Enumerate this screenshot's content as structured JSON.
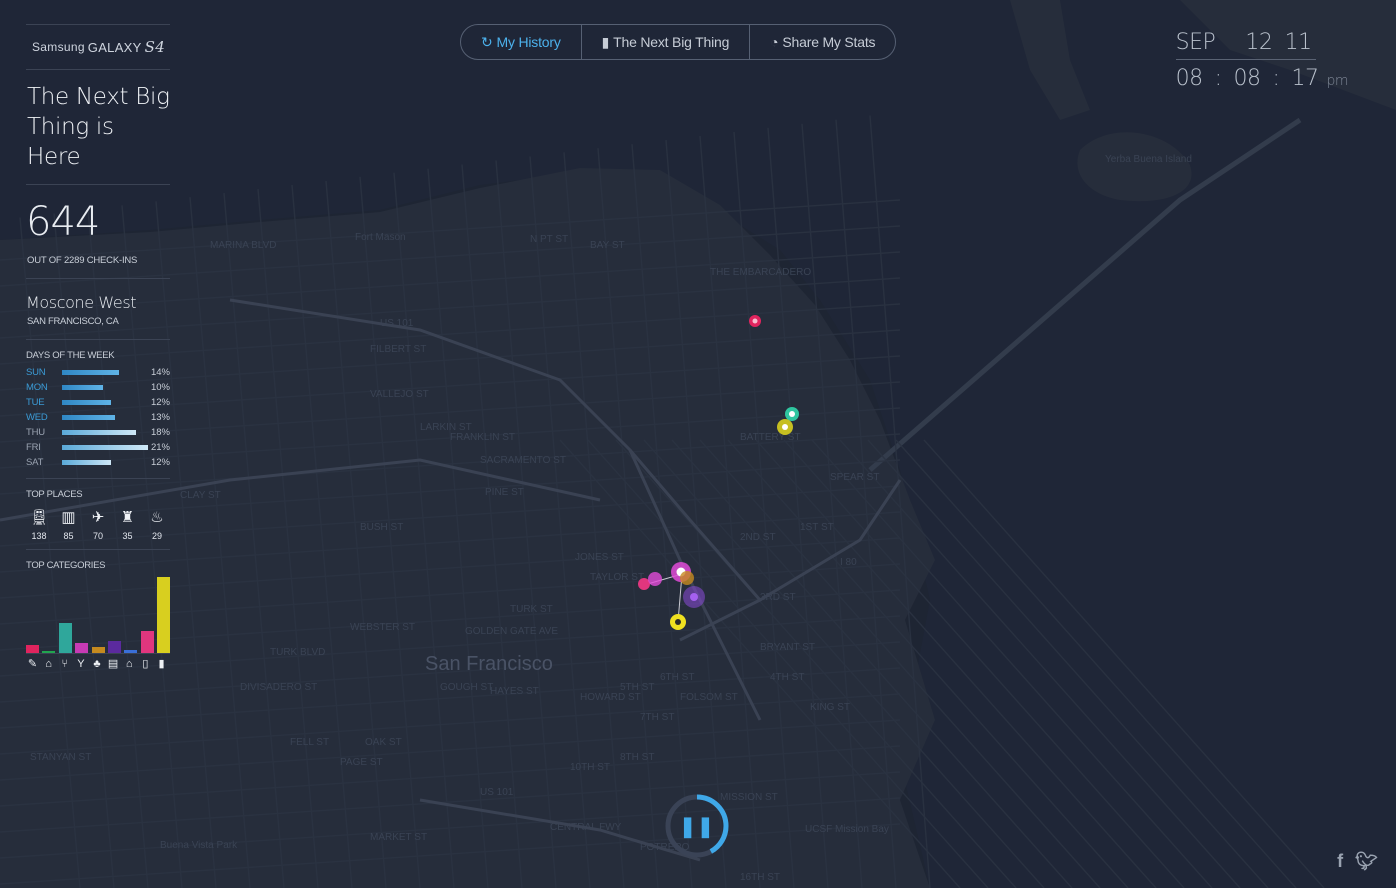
{
  "brand": {
    "maker": "Samsung",
    "product": "GALAXY",
    "model": "S4"
  },
  "headline": "The Next Big Thing is Here",
  "checkins": {
    "count": "644",
    "subtitle": "OUT OF 2289 CHECK-INS"
  },
  "venue": {
    "name": "Moscone West",
    "location": "SAN FRANCISCO, CA"
  },
  "days_of_week": {
    "label": "DAYS OF THE WEEK",
    "days": [
      {
        "day": "SUN",
        "pct": "14%",
        "value": 14
      },
      {
        "day": "MON",
        "pct": "10%",
        "value": 10
      },
      {
        "day": "TUE",
        "pct": "12%",
        "value": 12
      },
      {
        "day": "WED",
        "pct": "13%",
        "value": 13
      },
      {
        "day": "THU",
        "pct": "18%",
        "value": 18
      },
      {
        "day": "FRI",
        "pct": "21%",
        "value": 21
      },
      {
        "day": "SAT",
        "pct": "12%",
        "value": 12
      }
    ]
  },
  "top_places": {
    "label": "TOP PLACES",
    "items": [
      {
        "icon": "train-icon",
        "value": "138"
      },
      {
        "icon": "building-icon",
        "value": "85"
      },
      {
        "icon": "airplane-icon",
        "value": "70"
      },
      {
        "icon": "chair-icon",
        "value": "35"
      },
      {
        "icon": "fries-icon",
        "value": "29"
      }
    ]
  },
  "top_categories": {
    "label": "TOP CATEGORIES",
    "chart_data": {
      "type": "bar",
      "categories": [
        "arts",
        "education",
        "food",
        "nightlife",
        "outdoors",
        "professional",
        "residence",
        "shops",
        "travel"
      ],
      "values": [
        8,
        2,
        30,
        10,
        6,
        12,
        3,
        22,
        75
      ],
      "colors": [
        "#e0245e",
        "#21a54f",
        "#2fa79b",
        "#c73ab4",
        "#c58a1f",
        "#5b2a9e",
        "#3a6fd8",
        "#e0367e",
        "#d8cf1f"
      ]
    }
  },
  "nav": {
    "tabs": [
      {
        "label": "My History",
        "icon": "history-icon",
        "active": true
      },
      {
        "label": "The Next Big Thing",
        "icon": "bookmark-icon",
        "active": false
      },
      {
        "label": "Share My Stats",
        "icon": "stats-icon",
        "active": false
      }
    ]
  },
  "clock": {
    "month": "SEP",
    "day": "12",
    "year": "11",
    "hour": "08",
    "minute": "08",
    "second": "17",
    "ampm": "pm"
  },
  "map": {
    "city": "San Francisco",
    "labels": [
      "MARINA BLVD",
      "Fort Mason",
      "N PT ST",
      "BAY ST",
      "THE EMBARCADERO",
      "US 101",
      "FILBERT ST",
      "VALLEJO ST",
      "SACRAMENTO ST",
      "PINE ST",
      "BUSH ST",
      "CLAY ST",
      "TURK BLVD",
      "TURK ST",
      "GOLDEN GATE AVE",
      "HAYES ST",
      "FELL ST",
      "OAK ST",
      "PAGE ST",
      "FOLSOM ST",
      "BRYANT ST",
      "KING ST",
      "2ND ST",
      "3RD ST",
      "4TH ST",
      "5TH ST",
      "6TH ST",
      "7TH ST",
      "8TH ST",
      "10TH ST",
      "16TH ST",
      "MARKET ST",
      "JONES ST",
      "TAYLOR ST",
      "LARKIN ST",
      "FRANKLIN ST",
      "GOUGH ST",
      "WEBSTER ST",
      "DIVISADERO ST",
      "STANYAN ST",
      "MISSION ST",
      "POTRERO",
      "CENTRAL FWY",
      "I 80",
      "UCSF Mission Bay",
      "Buena Vista Park",
      "Yerba Buena Island",
      "BATTERY ST",
      "SPEAR ST",
      "1ST ST",
      "HOWARD ST",
      "US 101"
    ],
    "pin_colors": [
      "#e0245e",
      "#2fc6a0",
      "#d8cf1f",
      "#e24bd8",
      "#f0e020",
      "#8a4ad8",
      "#e0367e"
    ]
  },
  "player": {
    "state": "paused",
    "progress": 0.42,
    "accent": "#3fa8e8"
  },
  "social": {
    "facebook": "f",
    "twitter": "twitter"
  }
}
